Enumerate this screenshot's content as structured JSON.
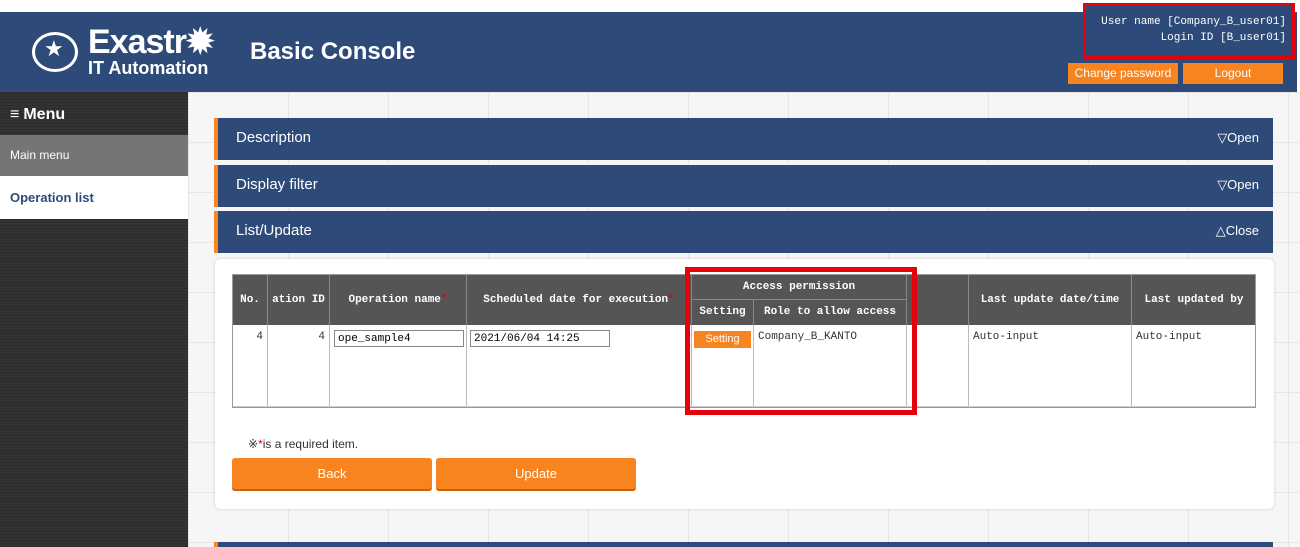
{
  "app": {
    "logo_word": "Exastr✹",
    "logo_sub": "IT Automation",
    "console_title": "Basic Console",
    "user_name": "User name [Company_B_user01]",
    "login_id": "Login ID [B_user01]",
    "change_password_label": "Change password",
    "logout_label": "Logout"
  },
  "sidebar": {
    "menu_icon": "≡",
    "menu_label": "Menu",
    "items": [
      {
        "label": "Main menu"
      },
      {
        "label": "Operation list"
      }
    ]
  },
  "sections": {
    "description": {
      "title": "Description",
      "toggle": "▽Open"
    },
    "display_filter": {
      "title": "Display filter",
      "toggle": "▽Open"
    },
    "list_update": {
      "title": "List/Update",
      "toggle": "△Close"
    }
  },
  "table": {
    "headers": {
      "no": "No.",
      "operation_id": "ation ID",
      "operation_name": "Operation name",
      "scheduled_date": "Scheduled date for execution",
      "access_permission": "Access permission",
      "setting": "Setting",
      "role_to_allow": "Role to allow access",
      "last_update": "Last update date/time",
      "last_updated_by": "Last updated by"
    },
    "required_mark": "*",
    "row": {
      "no": "4",
      "operation_id": "4",
      "operation_name": "ope_sample4",
      "scheduled_date": "2021/06/04 14:25",
      "setting_button": "Setting",
      "role": "Company_B_KANTO",
      "last_update": "Auto-input",
      "last_updated_by": "Auto-input"
    }
  },
  "note": {
    "prefix": "※",
    "mark": "*",
    "text": "is a required item."
  },
  "buttons": {
    "back": "Back",
    "update": "Update"
  },
  "colors": {
    "header_bg": "#2d4a78",
    "accent_orange": "#f7841e",
    "highlight_red": "#e8000b"
  }
}
